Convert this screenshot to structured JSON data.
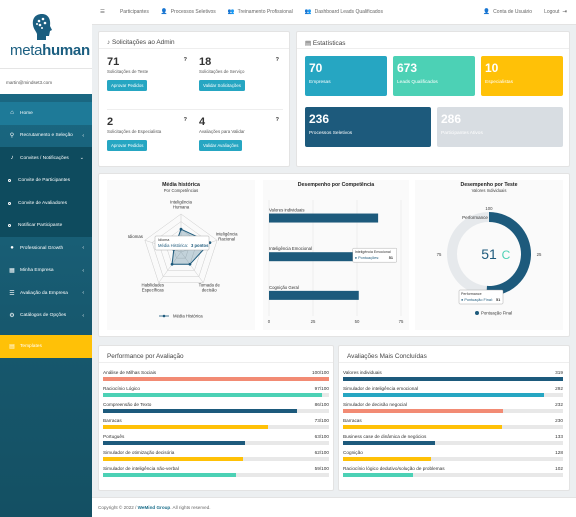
{
  "brand": {
    "name_light": "meta",
    "name_bold": "human"
  },
  "user": {
    "email": "martin@mindset3.com"
  },
  "sidebar": {
    "items": [
      {
        "label": "Home",
        "icon": "home-icon"
      },
      {
        "label": "Recrutamento e Seleção",
        "icon": "search-icon"
      },
      {
        "label": "Convites / Notificações",
        "icon": "bell-icon"
      },
      {
        "label": "Professional Growth",
        "icon": "dot-icon"
      },
      {
        "label": "Minha Empresa",
        "icon": "building-icon"
      },
      {
        "label": "Avaliação da Empresa",
        "icon": "list-icon"
      },
      {
        "label": "Catálogos de Opções",
        "icon": "gear-icon"
      },
      {
        "label": "Templates",
        "icon": "file-icon"
      }
    ],
    "sub": [
      {
        "label": "Convite de Participantes"
      },
      {
        "label": "Convite de Avaliadores"
      },
      {
        "label": "Notificar Participante"
      }
    ]
  },
  "topbar": {
    "participantes": "Participantes",
    "processos": "Processos Seletivos",
    "treinamento": "Treinamento Profissional",
    "dashboard": "Dashboard Leads Qualificados",
    "conta": "Conta de Usuário",
    "logout": "Logout"
  },
  "solicitacoes": {
    "title": "Solicitações ao Admin",
    "boxes": [
      {
        "num": "71",
        "label": "Solicitações de Teste",
        "btn": "Aprovar Pedidos"
      },
      {
        "num": "18",
        "label": "Solicitações de Serviço",
        "btn": "Validar Solicitações"
      },
      {
        "num": "2",
        "label": "Solicitações de Especialista",
        "btn": "Aprovar Pedidos"
      },
      {
        "num": "4",
        "label": "Avaliações para Validar",
        "btn": "Validar Avaliações"
      }
    ],
    "q": "?"
  },
  "estatisticas": {
    "title": "Estatísticas",
    "cards": [
      {
        "num": "70",
        "label": "Empresas",
        "color": "#26a6c2"
      },
      {
        "num": "673",
        "label": "Leads Qualificados",
        "color": "#4cd1b5"
      },
      {
        "num": "10",
        "label": "Especialistas",
        "color": "#ffc107"
      },
      {
        "num": "236",
        "label": "Processos Seletivos",
        "color": "#1d5a7c"
      },
      {
        "num": "286",
        "label": "Participantes Ativos",
        "color": "#d8dde2"
      }
    ]
  },
  "chart_data": [
    {
      "type": "radar",
      "title": "Média histórica",
      "subtitle": "Por Competências",
      "categories": [
        "Inteligência Humana",
        "Inteligência Racional",
        "Tomada de decisão",
        "Habilidades Específicas",
        "Idiomas"
      ],
      "series": [
        {
          "name": "Média Histórica",
          "values": [
            3,
            4,
            2,
            2,
            1
          ]
        }
      ],
      "tooltip": {
        "title": "Idioma",
        "series": "Média Histórica",
        "value": "3 pontos"
      },
      "legend": "bottom"
    },
    {
      "type": "bar",
      "orientation": "horizontal",
      "title": "Desempenho por Competência",
      "categories": [
        "Valores individuais",
        "Inteligência Emocional",
        "Cognição Geral"
      ],
      "values": [
        62,
        51,
        51
      ],
      "xlim": [
        0,
        75
      ],
      "xticks": [
        "0",
        "25",
        "50",
        "75"
      ],
      "tooltip": {
        "title": "Inteligência Emocional",
        "series": "Pontuações",
        "value": "51"
      }
    },
    {
      "type": "gauge",
      "title": "Desempenho por Teste",
      "subtitle": "Valores Individuais",
      "series_name": "Pontuação Final",
      "value": 51,
      "value_label": "51 C",
      "max": 100,
      "ticks": [
        "100",
        "75",
        "25"
      ],
      "label_top": "Performance",
      "tooltip": {
        "title": "Performance",
        "series": "Pontuação Final",
        "value": "51"
      }
    }
  ],
  "performance": {
    "title": "Performance por Avaliação",
    "rows": [
      {
        "label": "Análise de Milhas Sociais",
        "val": "100/100",
        "pct": 1.0,
        "color": "#f28b74"
      },
      {
        "label": "Raciocínio Lógico",
        "val": "97/100",
        "pct": 0.97,
        "color": "#4cd1b5"
      },
      {
        "label": "Compreensão de Texto",
        "val": "86/100",
        "pct": 0.86,
        "color": "#1d5a7c"
      },
      {
        "label": "Barracas",
        "val": "73/100",
        "pct": 0.73,
        "color": "#ffc107"
      },
      {
        "label": "Português",
        "val": "63/100",
        "pct": 0.63,
        "color": "#1d5a7c"
      },
      {
        "label": "Simulador de otimização decisória",
        "val": "62/100",
        "pct": 0.62,
        "color": "#ffc107"
      },
      {
        "label": "Simulador de inteligência não-verbal",
        "val": "59/100",
        "pct": 0.59,
        "color": "#4cd1b5"
      }
    ]
  },
  "concluidas": {
    "title": "Avaliações Mais Concluídas",
    "rows": [
      {
        "label": "Valores individuais",
        "val": "319",
        "pct": 1.0,
        "color": "#1d5a7c"
      },
      {
        "label": "Simulador de inteligência emocional",
        "val": "292",
        "pct": 0.915,
        "color": "#26a6c2"
      },
      {
        "label": "Simulador de decisão negocial",
        "val": "232",
        "pct": 0.727,
        "color": "#f28b74"
      },
      {
        "label": "Barracas",
        "val": "230",
        "pct": 0.721,
        "color": "#ffc107"
      },
      {
        "label": "Business case de dinâmica de negócios",
        "val": "133",
        "pct": 0.417,
        "color": "#1d5a7c"
      },
      {
        "label": "Cognição",
        "val": "128",
        "pct": 0.401,
        "color": "#ffc107"
      },
      {
        "label": "Raciocínio lógico dedutivo/solução de problemas",
        "val": "102",
        "pct": 0.32,
        "color": "#4cd1b5"
      }
    ]
  },
  "footer": {
    "prefix": "Copyright © 2022 / ",
    "company": "WeMind Group",
    "suffix": ". All rights reserved."
  }
}
